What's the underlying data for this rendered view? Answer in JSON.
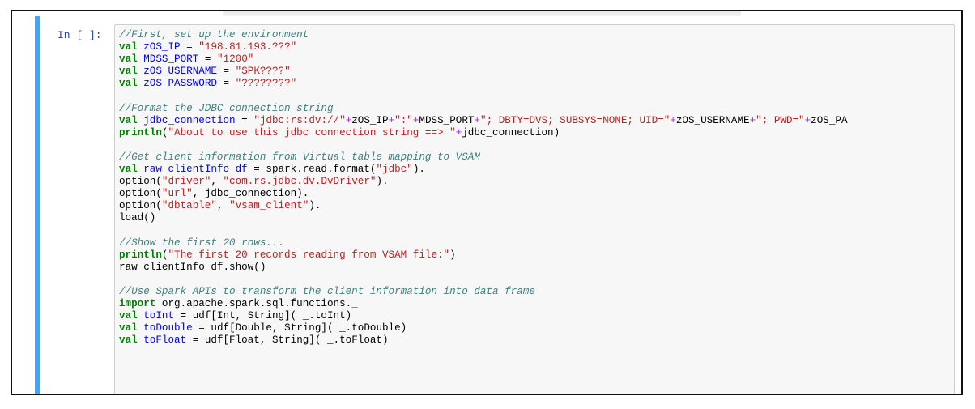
{
  "cell": {
    "prompt": "In [ ]:",
    "code_lines": [
      [
        {
          "t": "cm",
          "v": "//First, set up the environment"
        }
      ],
      [
        {
          "t": "kw",
          "v": "val"
        },
        {
          "t": "",
          "v": " "
        },
        {
          "t": "def",
          "v": "zOS_IP"
        },
        {
          "t": "",
          "v": " = "
        },
        {
          "t": "str",
          "v": "\"198.81.193.???\""
        }
      ],
      [
        {
          "t": "kw",
          "v": "val"
        },
        {
          "t": "",
          "v": " "
        },
        {
          "t": "def",
          "v": "MDSS_PORT"
        },
        {
          "t": "",
          "v": " = "
        },
        {
          "t": "str",
          "v": "\"1200\""
        }
      ],
      [
        {
          "t": "kw",
          "v": "val"
        },
        {
          "t": "",
          "v": " "
        },
        {
          "t": "def",
          "v": "zOS_USERNAME"
        },
        {
          "t": "",
          "v": " = "
        },
        {
          "t": "str",
          "v": "\"SPK????\""
        }
      ],
      [
        {
          "t": "kw",
          "v": "val"
        },
        {
          "t": "",
          "v": " "
        },
        {
          "t": "def",
          "v": "zOS_PASSWORD"
        },
        {
          "t": "",
          "v": " = "
        },
        {
          "t": "str",
          "v": "\"????????\""
        }
      ],
      [],
      [
        {
          "t": "cm",
          "v": "//Format the JDBC connection string"
        }
      ],
      [
        {
          "t": "kw",
          "v": "val"
        },
        {
          "t": "",
          "v": " "
        },
        {
          "t": "def",
          "v": "jdbc_connection"
        },
        {
          "t": "",
          "v": " = "
        },
        {
          "t": "str",
          "v": "\"jdbc:rs:dv://\""
        },
        {
          "t": "op",
          "v": "+"
        },
        {
          "t": "",
          "v": "zOS_IP"
        },
        {
          "t": "op",
          "v": "+"
        },
        {
          "t": "str",
          "v": "\":\""
        },
        {
          "t": "op",
          "v": "+"
        },
        {
          "t": "",
          "v": "MDSS_PORT"
        },
        {
          "t": "op",
          "v": "+"
        },
        {
          "t": "str",
          "v": "\"; DBTY=DVS; SUBSYS=NONE; UID=\""
        },
        {
          "t": "op",
          "v": "+"
        },
        {
          "t": "",
          "v": "zOS_USERNAME"
        },
        {
          "t": "op",
          "v": "+"
        },
        {
          "t": "str",
          "v": "\"; PWD=\""
        },
        {
          "t": "op",
          "v": "+"
        },
        {
          "t": "",
          "v": "zOS_PA"
        }
      ],
      [
        {
          "t": "kw",
          "v": "println"
        },
        {
          "t": "",
          "v": "("
        },
        {
          "t": "str",
          "v": "\"About to use this jdbc connection string ==> \""
        },
        {
          "t": "op",
          "v": "+"
        },
        {
          "t": "",
          "v": "jdbc_connection)"
        }
      ],
      [],
      [
        {
          "t": "cm",
          "v": "//Get client information from Virtual table mapping to VSAM"
        }
      ],
      [
        {
          "t": "kw",
          "v": "val"
        },
        {
          "t": "",
          "v": " "
        },
        {
          "t": "def",
          "v": "raw_clientInfo_df"
        },
        {
          "t": "",
          "v": " = spark.read.format("
        },
        {
          "t": "str",
          "v": "\"jdbc\""
        },
        {
          "t": "",
          "v": ")."
        }
      ],
      [
        {
          "t": "",
          "v": "option("
        },
        {
          "t": "str",
          "v": "\"driver\""
        },
        {
          "t": "",
          "v": ", "
        },
        {
          "t": "str",
          "v": "\"com.rs.jdbc.dv.DvDriver\""
        },
        {
          "t": "",
          "v": ")."
        }
      ],
      [
        {
          "t": "",
          "v": "option("
        },
        {
          "t": "str",
          "v": "\"url\""
        },
        {
          "t": "",
          "v": ", jdbc_connection)."
        }
      ],
      [
        {
          "t": "",
          "v": "option("
        },
        {
          "t": "str",
          "v": "\"dbtable\""
        },
        {
          "t": "",
          "v": ", "
        },
        {
          "t": "str",
          "v": "\"vsam_client\""
        },
        {
          "t": "",
          "v": ")."
        }
      ],
      [
        {
          "t": "",
          "v": "load()"
        }
      ],
      [],
      [
        {
          "t": "cm",
          "v": "//Show the first 20 rows..."
        }
      ],
      [
        {
          "t": "kw",
          "v": "println"
        },
        {
          "t": "",
          "v": "("
        },
        {
          "t": "str",
          "v": "\"The first 20 records reading from VSAM file:\""
        },
        {
          "t": "",
          "v": ")"
        }
      ],
      [
        {
          "t": "",
          "v": "raw_clientInfo_df.show()"
        }
      ],
      [],
      [
        {
          "t": "cm",
          "v": "//Use Spark APIs to transform the client information into data frame"
        }
      ],
      [
        {
          "t": "kw",
          "v": "import"
        },
        {
          "t": "",
          "v": " org.apache.spark.sql.functions."
        },
        {
          "t": "kw",
          "v": "_"
        }
      ],
      [
        {
          "t": "kw",
          "v": "val"
        },
        {
          "t": "",
          "v": " "
        },
        {
          "t": "def",
          "v": "toInt"
        },
        {
          "t": "",
          "v": " = udf[Int, String]( _.toInt)"
        }
      ],
      [
        {
          "t": "kw",
          "v": "val"
        },
        {
          "t": "",
          "v": " "
        },
        {
          "t": "def",
          "v": "toDouble"
        },
        {
          "t": "",
          "v": " = udf[Double, String]( _.toDouble)"
        }
      ],
      [
        {
          "t": "kw",
          "v": "val"
        },
        {
          "t": "",
          "v": " "
        },
        {
          "t": "def",
          "v": "toFloat"
        },
        {
          "t": "",
          "v": " = udf[Float, String]( _.toFloat)"
        }
      ]
    ]
  },
  "colors": {
    "accent": "#42a5f5",
    "comment": "#408080",
    "keyword": "#008000",
    "string": "#ba2121",
    "definition": "#0000ff",
    "operator": "#aa22ff",
    "prompt": "#303f9f"
  }
}
